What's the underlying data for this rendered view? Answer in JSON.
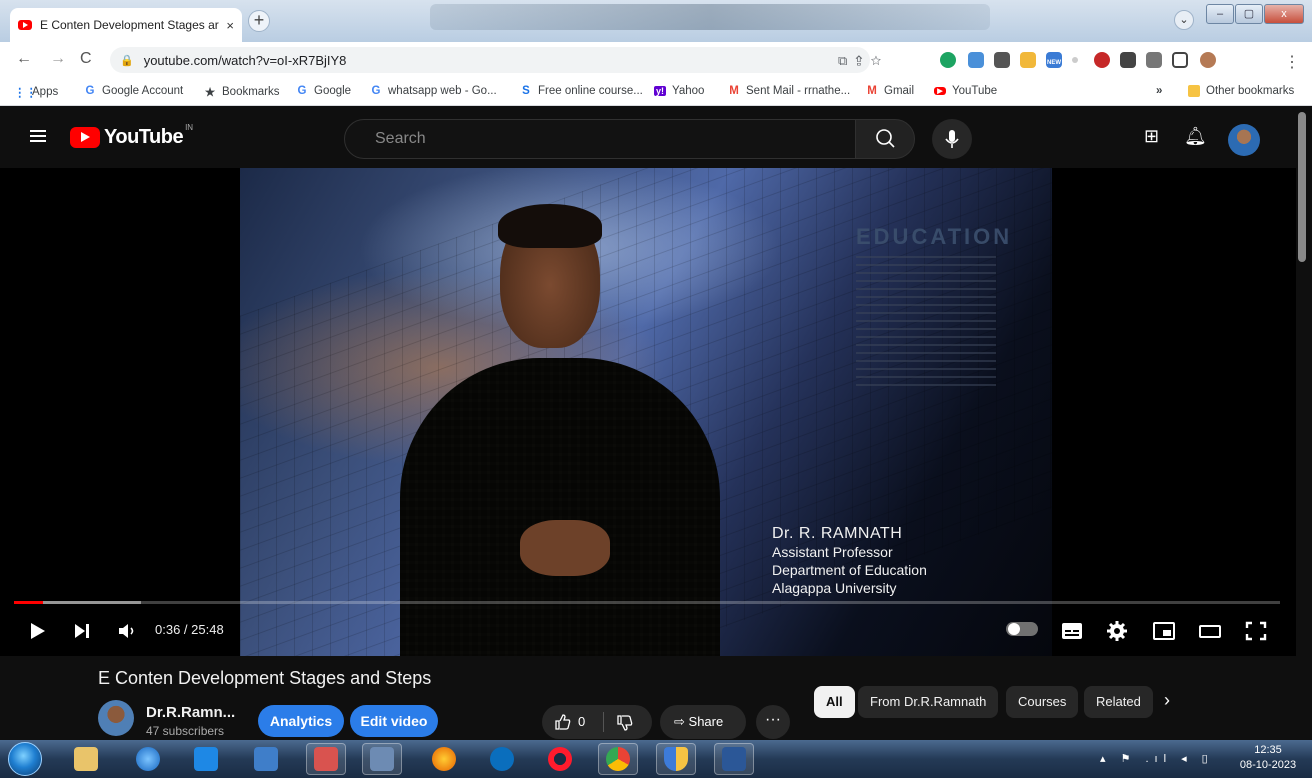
{
  "browser": {
    "tab_title": "E Conten Development Stages ar",
    "tab_close": "×",
    "new_tab": "+",
    "url": "youtube.com/watch?v=oI-xR7BjIY8",
    "window_controls": [
      "–",
      "▢",
      "x"
    ],
    "ext_new_badge": "NEW",
    "bookmarks": [
      {
        "label": "Apps",
        "icon": "apps-grid-icon",
        "color": "#1a73e8"
      },
      {
        "label": "Google Account",
        "icon": "google-icon",
        "color": "#4285f4"
      },
      {
        "label": "Bookmarks",
        "icon": "star-icon",
        "color": "#3c4043"
      },
      {
        "label": "Google",
        "icon": "google-icon",
        "color": "#4285f4"
      },
      {
        "label": "whatsapp web - Go...",
        "icon": "google-icon",
        "color": "#4285f4"
      },
      {
        "label": "Free online course...",
        "icon": "s-logo-icon",
        "color": "#1a73e8"
      },
      {
        "label": "Yahoo",
        "icon": "yahoo-icon",
        "color": "#6001d2"
      },
      {
        "label": "Sent Mail - rrnathe...",
        "icon": "gmail-icon",
        "color": "#ea4335"
      },
      {
        "label": "Gmail",
        "icon": "gmail-icon",
        "color": "#ea4335"
      },
      {
        "label": "YouTube",
        "icon": "youtube-icon",
        "color": "#ff0000"
      }
    ],
    "more_bookmarks": "»",
    "other_bookmarks": "Other bookmarks"
  },
  "youtube": {
    "logo_text": "YouTube",
    "country_code": "IN",
    "search_placeholder": "Search"
  },
  "video": {
    "overlay_heading": "EDUCATION",
    "presenter_name": "Dr. R. RAMNATH",
    "presenter_lines": [
      "Assistant Professor",
      "Department of Education",
      "Alagappa University"
    ],
    "time": "0:36 / 25:48",
    "played_fraction": 0.023,
    "buffered_fraction": 0.1
  },
  "details": {
    "title": "E Conten Development Stages and Steps",
    "channel_name": "Dr.R.Ramn...",
    "subscribers": "47 subscribers",
    "analytics_label": "Analytics",
    "edit_label": "Edit video",
    "likes": "0",
    "share_label": "Share",
    "more_label": "···"
  },
  "chips": [
    "All",
    "From Dr.R.Ramnath",
    "Courses",
    "Related"
  ],
  "taskbar": {
    "clock_time": "12:35",
    "clock_date": "08-10-2023"
  },
  "colors": {
    "yt_red": "#ff0000",
    "accent_blue": "#2b7de9",
    "yt_bg": "#0f0f0f"
  }
}
